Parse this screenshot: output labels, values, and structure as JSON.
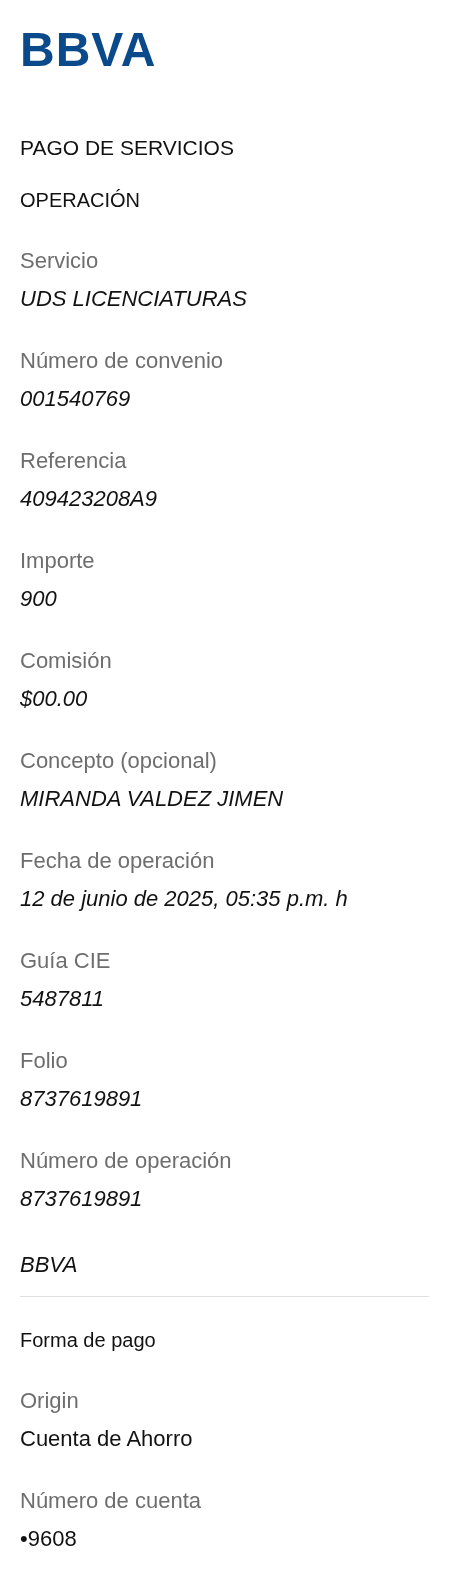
{
  "logo": "BBVA",
  "title": "PAGO DE SERVICIOS",
  "operacion": {
    "heading": "OPERACIÓN",
    "fields": [
      {
        "label": "Servicio",
        "value": "UDS LICENCIATURAS"
      },
      {
        "label": "Número de convenio",
        "value": "001540769"
      },
      {
        "label": "Referencia",
        "value": "409423208A9"
      },
      {
        "label": "Importe",
        "value": "900"
      },
      {
        "label": "Comisión",
        "value": "$00.00"
      },
      {
        "label": "Concepto (opcional)",
        "value": "MIRANDA VALDEZ JIMEN"
      },
      {
        "label": "Fecha de operación",
        "value": "12 de junio de 2025, 05:35 p.m. h"
      },
      {
        "label": "Guía CIE",
        "value": "5487811"
      },
      {
        "label": "Folio",
        "value": "8737619891"
      },
      {
        "label": "Número de operación",
        "value": "8737619891"
      }
    ],
    "bank": "BBVA"
  },
  "forma_de_pago": {
    "heading": "Forma de pago",
    "fields": [
      {
        "label": "Origin",
        "value": "Cuenta de Ahorro"
      },
      {
        "label": "Número de cuenta",
        "value": "•9608"
      }
    ]
  }
}
